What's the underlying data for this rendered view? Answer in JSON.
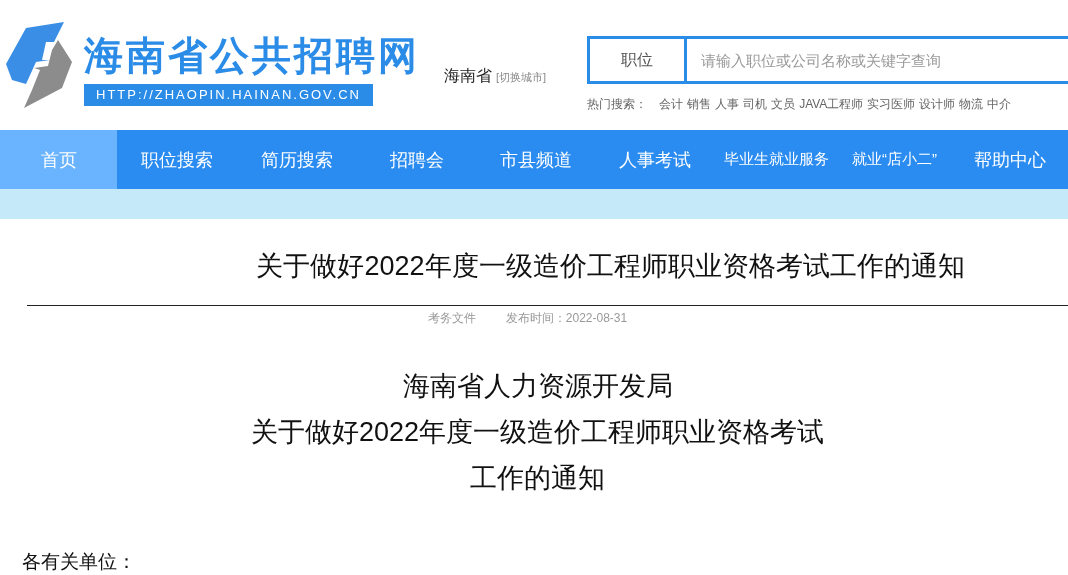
{
  "header": {
    "site_name": "海南省公共招聘网",
    "site_url": "HTTP://ZHAOPIN.HAINAN.GOV.CN",
    "region": "海南省",
    "switch_city": "[切换城市]",
    "search": {
      "category": "职位",
      "placeholder": "请输入职位或公司名称或关键字查询"
    },
    "hot_search": {
      "label": "热门搜索：",
      "terms": [
        "会计",
        "销售",
        "人事",
        "司机",
        "文员",
        "JAVA工程师",
        "实习医师",
        "设计师",
        "物流",
        "中介"
      ]
    }
  },
  "nav": [
    {
      "label": "首页",
      "selected": true
    },
    {
      "label": "职位搜索",
      "selected": false
    },
    {
      "label": "简历搜索",
      "selected": false
    },
    {
      "label": "招聘会",
      "selected": false
    },
    {
      "label": "市县频道",
      "selected": false
    },
    {
      "label": "人事考试",
      "selected": false
    },
    {
      "label": "毕业生就业服务",
      "selected": false
    },
    {
      "label": "就业“店小二”",
      "selected": false
    },
    {
      "label": "帮助中心",
      "selected": false
    }
  ],
  "article": {
    "title": "关于做好2022年度一级造价工程师职业资格考试工作的通知",
    "category": "考务文件",
    "published": "发布时间：2022-08-31",
    "heading": [
      "海南省人力资源开发局",
      "关于做好2022年度一级造价工程师职业资格考试",
      "工作的通知"
    ],
    "salutation": "各有关单位："
  }
}
